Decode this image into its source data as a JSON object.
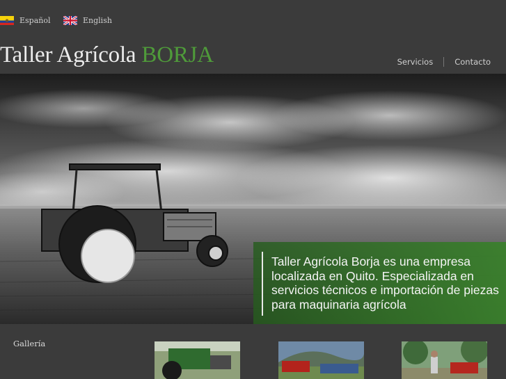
{
  "languages": [
    {
      "label": "Español",
      "flag": "ecuador-flag-icon"
    },
    {
      "label": "English",
      "flag": "uk-flag-icon"
    }
  ],
  "logo": {
    "prefix": "Taller Agrícola ",
    "brand": "BORJA"
  },
  "nav": {
    "servicios": "Servicios",
    "contacto": "Contacto"
  },
  "hero": {
    "caption": "Taller Agrícola Borja es una empresa localizada en Quito. Especializada en servicios técnicos e importación de piezas para maquinaria agrícola"
  },
  "footer": {
    "gallery_label": "Gallería"
  },
  "colors": {
    "background": "#3b3b3b",
    "brand_green": "#4f9b3a",
    "caption_green": "#3a802c"
  }
}
